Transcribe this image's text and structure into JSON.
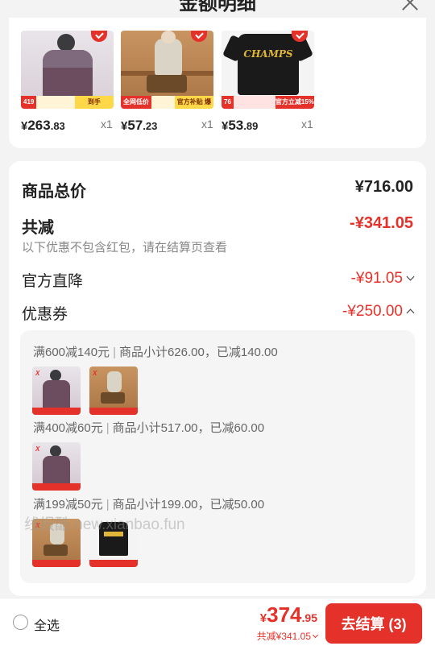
{
  "header": {
    "title": "金额明细"
  },
  "products": [
    {
      "price_symbol": "¥",
      "price_int": "263",
      "price_dec": ".83",
      "qty": "x1",
      "strip_left": "419",
      "strip_right": "到手"
    },
    {
      "price_symbol": "¥",
      "price_int": "57",
      "price_dec": ".23",
      "qty": "x1",
      "strip_left": "全网低价",
      "strip_right": "官方补贴 爆款直降"
    },
    {
      "price_symbol": "¥",
      "price_int": "53",
      "price_dec": ".89",
      "qty": "x1",
      "strip_left": "76",
      "strip_right": "官方立减15%",
      "product_text": "CHAMPS"
    }
  ],
  "summary": {
    "total_label": "商品总价",
    "total_value": "¥716.00",
    "discount_label": "共减",
    "discount_value": "-¥341.05",
    "discount_note": "以下优惠不包含红包，请在结算页查看",
    "official_label": "官方直降",
    "official_value": "-¥91.05",
    "coupon_label": "优惠券",
    "coupon_value": "-¥250.00"
  },
  "coupon_tiers": [
    {
      "rule": "满600减140元",
      "sep": "|",
      "detail": "商品小计626.00，已减140.00"
    },
    {
      "rule": "满400减60元",
      "sep": "|",
      "detail": "商品小计517.00，已减60.00"
    },
    {
      "rule": "满199减50元",
      "sep": "|",
      "detail": "商品小计199.00，已减50.00"
    }
  ],
  "watermark": "线报酷 new.xianbao.fun",
  "footer": {
    "select_all": "全选",
    "total_symbol": "¥",
    "total_int": "374",
    "total_dec": ".95",
    "saved": "共减¥341.05",
    "checkout": "去结算 (3)"
  },
  "colors": {
    "accent": "#e4322b",
    "background": "#f3f3f3"
  }
}
